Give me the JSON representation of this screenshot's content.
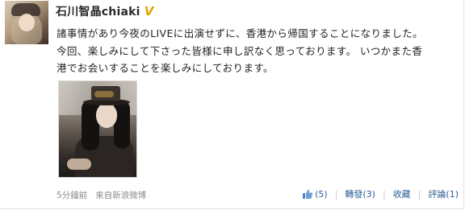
{
  "user": {
    "name": "石川智晶chiaki",
    "verified_mark": "V"
  },
  "post": {
    "lines": [
      "諸事情があり今夜のLIVEに出演せずに、香港から帰国することになりました。",
      "今回、楽しみにして下さった皆様に申し訳なく思っております。 いつかまた香",
      "港でお会いすることを楽しみにしております。"
    ]
  },
  "meta": {
    "timestamp": "5分鐘前",
    "source": "來自新浪微博"
  },
  "actions": {
    "like_count": "(5)",
    "repost_label": "轉發",
    "repost_count": "(3)",
    "favorite_label": "收藏",
    "comment_label": "評論",
    "comment_count": "(1)",
    "separator": "|"
  },
  "colors": {
    "link": "#2a5f93",
    "verified": "#e6a400",
    "muted": "#8a8a8a"
  }
}
